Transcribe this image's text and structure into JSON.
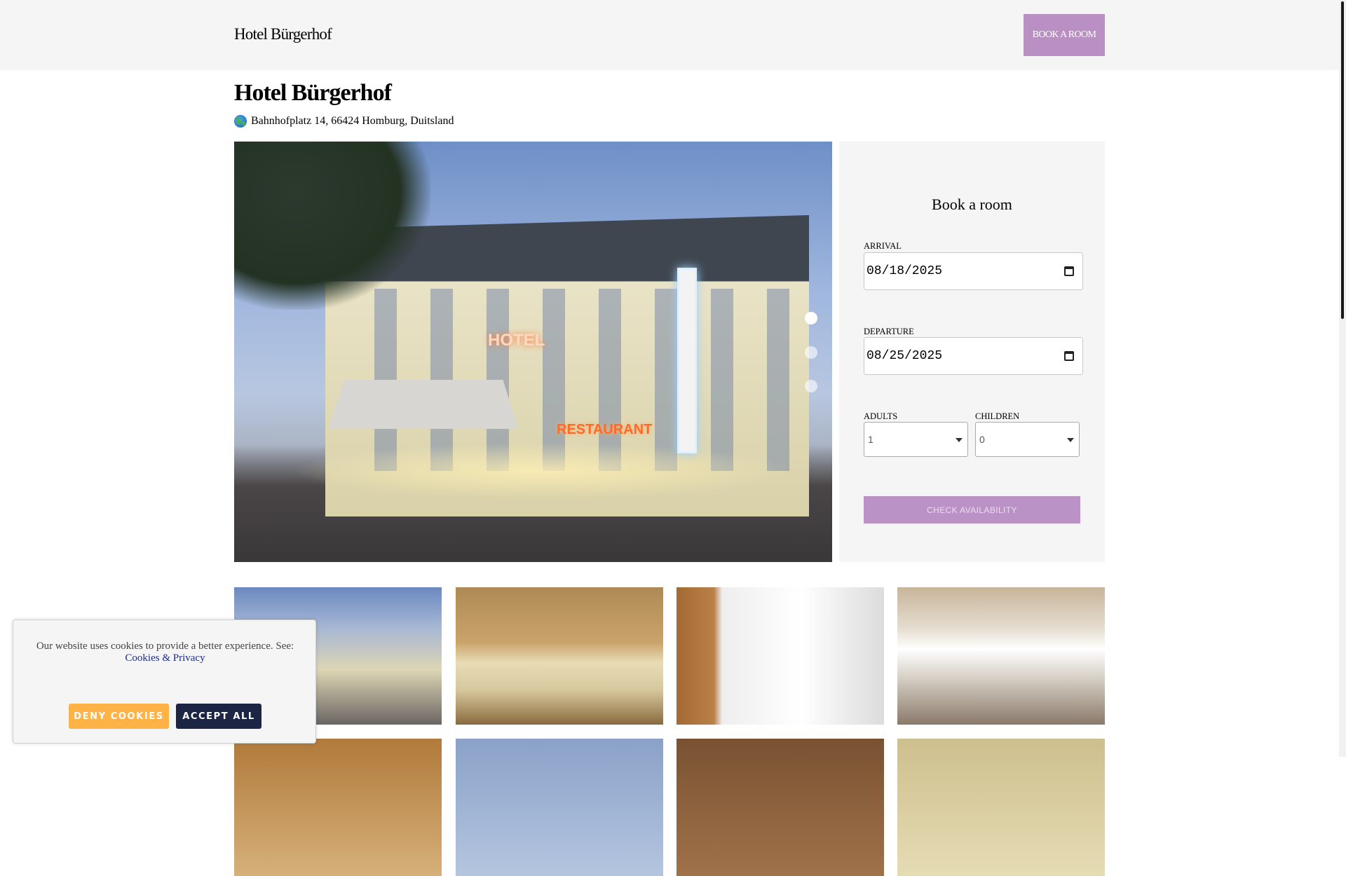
{
  "header": {
    "brand": "Hotel Bürgerhof",
    "book_button": "BOOK A ROOM"
  },
  "hotel": {
    "title": "Hotel Bürgerhof",
    "address": "Bahnhofplatz 14, 66424 Homburg, Duitsland",
    "address_icon": "globe-icon"
  },
  "hero": {
    "image_alt": "Hotel Bürgerhof exterior at dusk",
    "sign_hotel": "HOTEL",
    "sign_restaurant": "RESTAURANT",
    "active_slide": 1,
    "slide_count": 3
  },
  "booking": {
    "title": "Book a room",
    "arrival_label": "ARRIVAL",
    "arrival_value": "08/18/2025",
    "departure_label": "DEPARTURE",
    "departure_value": "08/25/2025",
    "adults_label": "ADULTS",
    "adults_value": "1",
    "children_label": "CHILDREN",
    "children_value": "0",
    "check_button": "CHECK AVAILABILITY"
  },
  "gallery": {
    "items": [
      {
        "name": "exterior"
      },
      {
        "name": "bedroom"
      },
      {
        "name": "bathroom"
      },
      {
        "name": "restaurant"
      },
      {
        "name": "photo-5"
      },
      {
        "name": "photo-6"
      },
      {
        "name": "photo-7"
      },
      {
        "name": "photo-8"
      }
    ]
  },
  "cookie": {
    "text": "Our website uses cookies to provide a better experience. See:",
    "link": "Cookies & Privacy",
    "deny": "DENY COOKIES",
    "accept": "ACCEPT ALL"
  },
  "colors": {
    "accent": "#b98fc4",
    "deny": "#ffb347",
    "accept": "#1d2545",
    "panel": "#f5f5f5"
  }
}
